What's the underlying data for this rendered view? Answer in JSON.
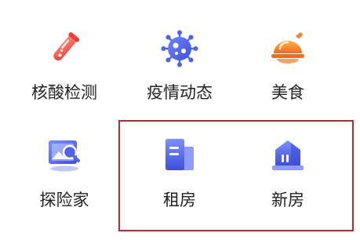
{
  "services": [
    {
      "label": "核酸检测",
      "icon": "test-tube-icon",
      "color": "#ef5a52"
    },
    {
      "label": "疫情动态",
      "icon": "virus-icon",
      "color": "#4f63e8"
    },
    {
      "label": "美食",
      "icon": "roast-chicken-icon",
      "color": "#f7812a"
    },
    {
      "label": "探险家",
      "icon": "photo-search-icon",
      "color": "#4f63e8"
    },
    {
      "label": "租房",
      "icon": "buildings-icon",
      "color": "#4f63e8"
    },
    {
      "label": "新房",
      "icon": "house-icon",
      "color": "#4f63e8"
    }
  ],
  "annotation": {
    "color": "#c4262a"
  }
}
